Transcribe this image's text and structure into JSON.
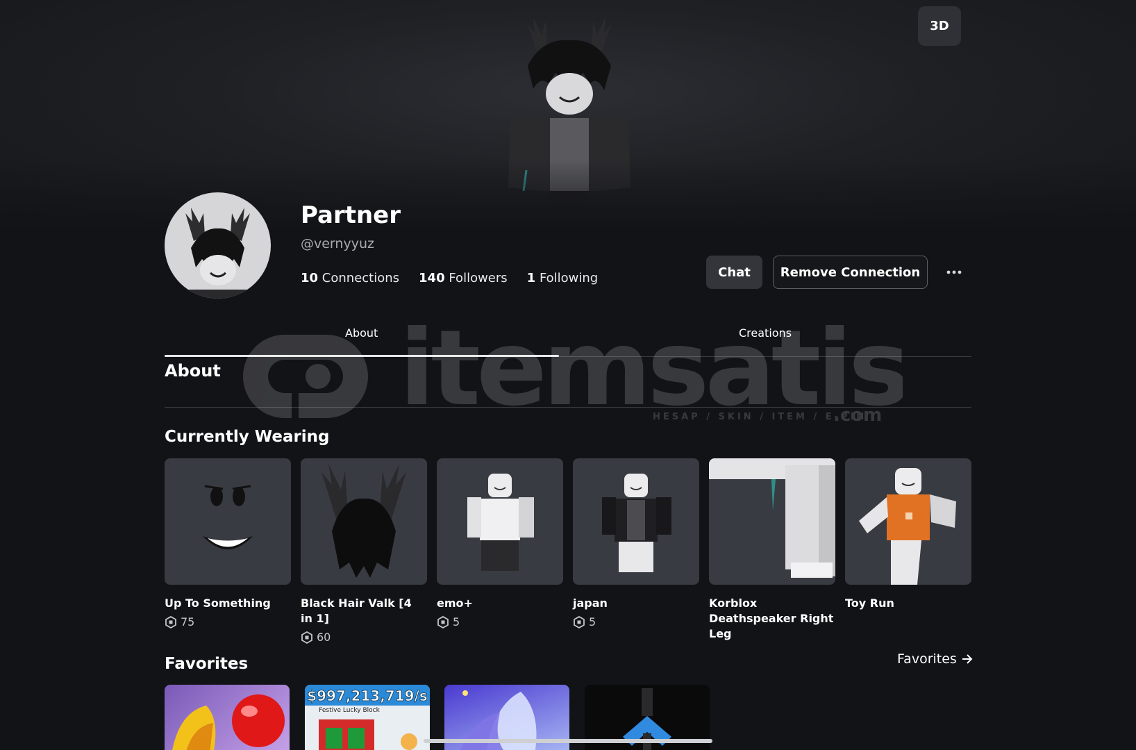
{
  "hero": {
    "btn_3d_label": "3D"
  },
  "profile": {
    "display_name": "Partner",
    "username": "@vernyyuz",
    "stats": [
      {
        "count": "10",
        "label": "Connections"
      },
      {
        "count": "140",
        "label": "Followers"
      },
      {
        "count": "1",
        "label": "Following"
      }
    ],
    "chat_label": "Chat",
    "remove_label": "Remove Connection"
  },
  "tabs": [
    {
      "label": "About",
      "active": true
    },
    {
      "label": "Creations",
      "active": false
    }
  ],
  "about": {
    "title": "About"
  },
  "watermark": {
    "brand": "itemsatis",
    "tagline": "HESAP / SKIN / ITEM / E-PIN",
    "suffix": ".com"
  },
  "wearing": {
    "title": "Currently Wearing",
    "items": [
      {
        "name": "Up To Something",
        "price": "75"
      },
      {
        "name": "Black Hair Valk [4 in 1]",
        "price": "60"
      },
      {
        "name": "emo+",
        "price": "5"
      },
      {
        "name": "japan",
        "price": "5"
      },
      {
        "name": "Korblox Deathspeaker Right Leg",
        "price": ""
      },
      {
        "name": "Toy Run",
        "price": ""
      }
    ]
  },
  "favorites": {
    "title": "Favorites",
    "link_label": "Favorites",
    "thumb_texts": {
      "price_banner": "$997,213,719/s",
      "sub_banner": "Festive Lucky Block"
    }
  },
  "colors": {
    "background": "#121317",
    "card": "#393b42",
    "accent_orange": "#e27223"
  }
}
